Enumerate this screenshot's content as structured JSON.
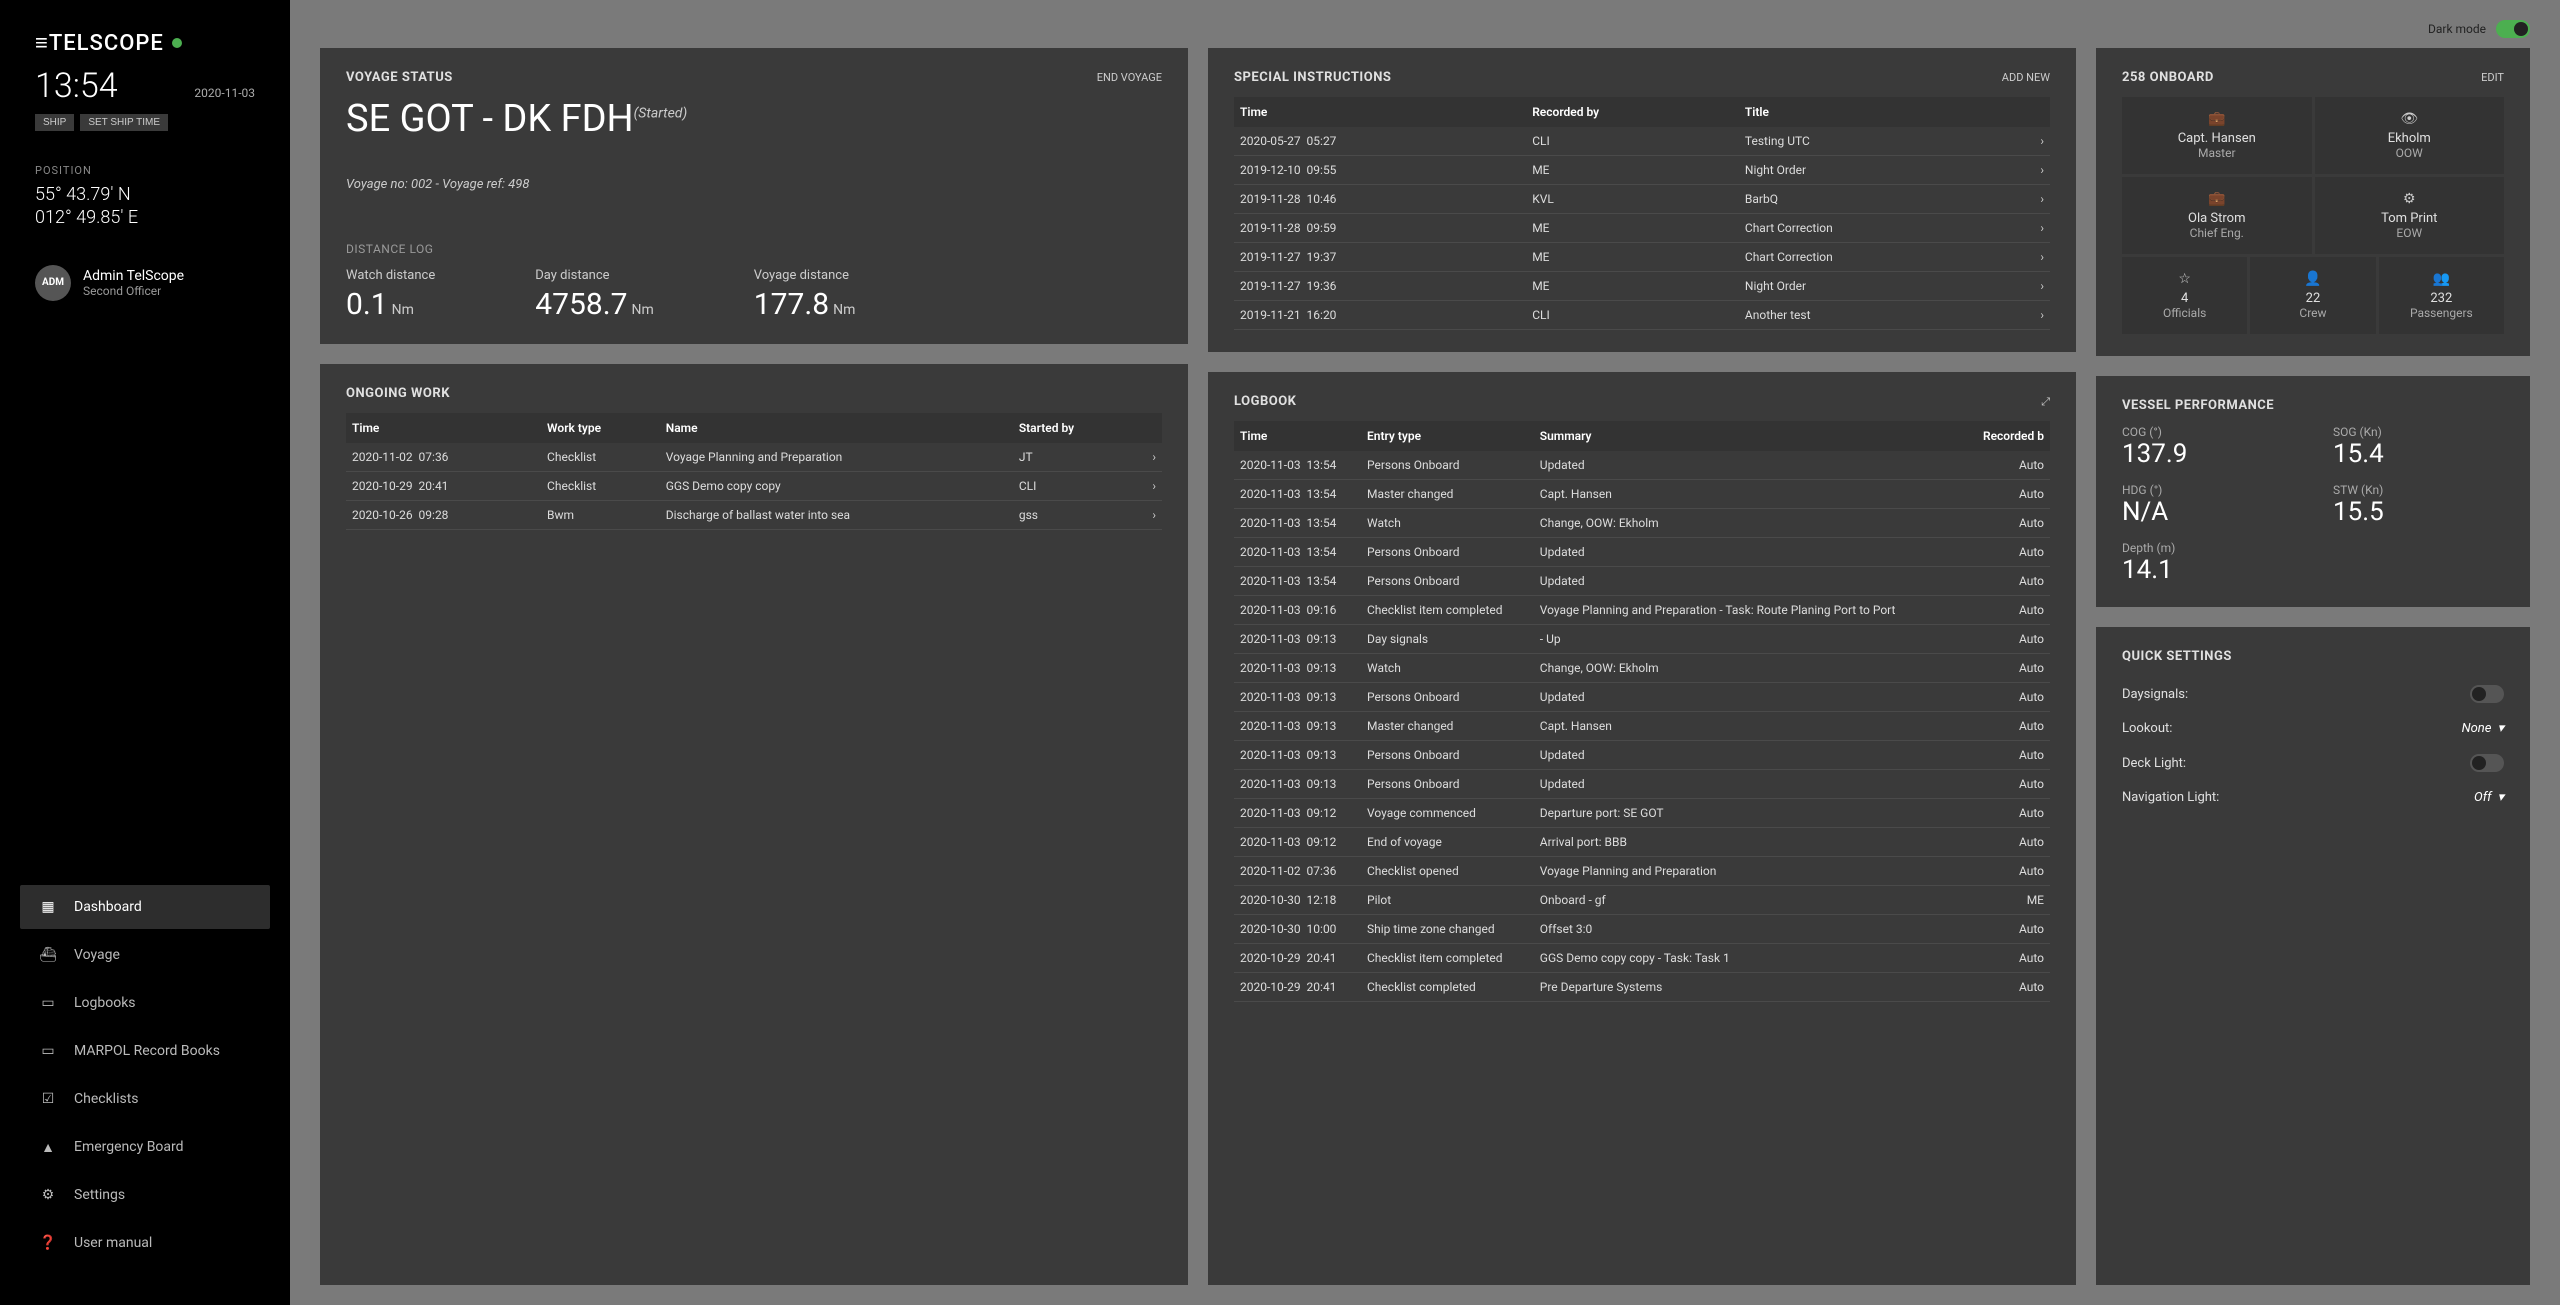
{
  "brand": "≡TELSCOPE",
  "clock": {
    "time": "13:54",
    "date": "2020-11-03"
  },
  "ship_buttons": {
    "ship": "SHIP",
    "set_time": "SET SHIP TIME"
  },
  "position": {
    "label": "POSITION",
    "lat": "55° 43.79' N",
    "lon": "012° 49.85' E"
  },
  "user": {
    "badge": "ADM",
    "name": "Admin TelScope",
    "role": "Second Officer"
  },
  "nav": {
    "dashboard": "Dashboard",
    "voyage": "Voyage",
    "logbooks": "Logbooks",
    "marpol": "MARPOL Record Books",
    "checklists": "Checklists",
    "emergency": "Emergency Board",
    "settings": "Settings",
    "manual": "User manual"
  },
  "topbar": {
    "dark_mode": "Dark mode"
  },
  "voyage_status": {
    "title": "VOYAGE STATUS",
    "action": "END VOYAGE",
    "route": "SE GOT - DK FDH",
    "status": "(Started)",
    "ref": "Voyage no: 002 - Voyage ref: 498",
    "distlog_label": "DISTANCE LOG",
    "watch": {
      "label": "Watch distance",
      "value": "0.1",
      "unit": "Nm"
    },
    "day": {
      "label": "Day distance",
      "value": "4758.7",
      "unit": "Nm"
    },
    "voyage": {
      "label": "Voyage distance",
      "value": "177.8",
      "unit": "Nm"
    }
  },
  "ongoing": {
    "title": "ONGOING WORK",
    "headers": {
      "time": "Time",
      "type": "Work type",
      "name": "Name",
      "by": "Started by"
    },
    "rows": [
      {
        "date": "2020-11-02",
        "time": "07:36",
        "type": "Checklist",
        "name": "Voyage Planning and Preparation",
        "by": "JT"
      },
      {
        "date": "2020-10-29",
        "time": "20:41",
        "type": "Checklist",
        "name": "GGS Demo copy copy",
        "by": "CLI"
      },
      {
        "date": "2020-10-26",
        "time": "09:28",
        "type": "Bwm",
        "name": "Discharge of ballast water into sea",
        "by": "gss"
      }
    ]
  },
  "instructions": {
    "title": "SPECIAL INSTRUCTIONS",
    "action": "ADD NEW",
    "headers": {
      "time": "Time",
      "by": "Recorded by",
      "title": "Title"
    },
    "rows": [
      {
        "date": "2020-05-27",
        "time": "05:27",
        "by": "CLI",
        "title": "Testing UTC"
      },
      {
        "date": "2019-12-10",
        "time": "09:55",
        "by": "ME",
        "title": "Night Order"
      },
      {
        "date": "2019-11-28",
        "time": "10:46",
        "by": "KVL",
        "title": "BarbQ"
      },
      {
        "date": "2019-11-28",
        "time": "09:59",
        "by": "ME",
        "title": "Chart Correction"
      },
      {
        "date": "2019-11-27",
        "time": "19:37",
        "by": "ME",
        "title": "Chart Correction"
      },
      {
        "date": "2019-11-27",
        "time": "19:36",
        "by": "ME",
        "title": "Night Order"
      },
      {
        "date": "2019-11-21",
        "time": "16:20",
        "by": "CLI",
        "title": "Another test"
      }
    ]
  },
  "logbook": {
    "title": "LOGBOOK",
    "headers": {
      "time": "Time",
      "type": "Entry type",
      "summary": "Summary",
      "by": "Recorded b"
    },
    "rows": [
      {
        "date": "2020-11-03",
        "time": "13:54",
        "type": "Persons Onboard",
        "summary": "Updated",
        "by": "Auto"
      },
      {
        "date": "2020-11-03",
        "time": "13:54",
        "type": "Master changed",
        "summary": "Capt. Hansen",
        "by": "Auto"
      },
      {
        "date": "2020-11-03",
        "time": "13:54",
        "type": "Watch",
        "summary": "Change, OOW: Ekholm",
        "by": "Auto"
      },
      {
        "date": "2020-11-03",
        "time": "13:54",
        "type": "Persons Onboard",
        "summary": "Updated",
        "by": "Auto"
      },
      {
        "date": "2020-11-03",
        "time": "13:54",
        "type": "Persons Onboard",
        "summary": "Updated",
        "by": "Auto"
      },
      {
        "date": "2020-11-03",
        "time": "09:16",
        "type": "Checklist item completed",
        "summary": "Voyage Planning and Preparation - Task: Route Planing Port to Port",
        "by": "Auto"
      },
      {
        "date": "2020-11-03",
        "time": "09:13",
        "type": "Day signals",
        "summary": "- Up",
        "by": "Auto"
      },
      {
        "date": "2020-11-03",
        "time": "09:13",
        "type": "Watch",
        "summary": "Change, OOW: Ekholm",
        "by": "Auto"
      },
      {
        "date": "2020-11-03",
        "time": "09:13",
        "type": "Persons Onboard",
        "summary": "Updated",
        "by": "Auto"
      },
      {
        "date": "2020-11-03",
        "time": "09:13",
        "type": "Master changed",
        "summary": "Capt. Hansen",
        "by": "Auto"
      },
      {
        "date": "2020-11-03",
        "time": "09:13",
        "type": "Persons Onboard",
        "summary": "Updated",
        "by": "Auto"
      },
      {
        "date": "2020-11-03",
        "time": "09:13",
        "type": "Persons Onboard",
        "summary": "Updated",
        "by": "Auto"
      },
      {
        "date": "2020-11-03",
        "time": "09:12",
        "type": "Voyage commenced",
        "summary": "Departure port: SE GOT",
        "by": "Auto"
      },
      {
        "date": "2020-11-03",
        "time": "09:12",
        "type": "End of voyage",
        "summary": "Arrival port: BBB",
        "by": "Auto"
      },
      {
        "date": "2020-11-02",
        "time": "07:36",
        "type": "Checklist opened",
        "summary": "Voyage Planning and Preparation",
        "by": "Auto"
      },
      {
        "date": "2020-10-30",
        "time": "12:18",
        "type": "Pilot",
        "summary": "Onboard - gf",
        "by": "ME"
      },
      {
        "date": "2020-10-30",
        "time": "10:00",
        "type": "Ship time zone changed",
        "summary": "Offset 3:0",
        "by": "Auto"
      },
      {
        "date": "2020-10-29",
        "time": "20:41",
        "type": "Checklist item completed",
        "summary": "GGS Demo copy copy - Task: Task 1",
        "by": "Auto"
      },
      {
        "date": "2020-10-29",
        "time": "20:41",
        "type": "Checklist completed",
        "summary": "Pre Departure Systems",
        "by": "Auto"
      }
    ]
  },
  "onboard": {
    "title": "258 ONBOARD",
    "action": "EDIT",
    "crew": [
      {
        "icon": "briefcase",
        "name": "Capt. Hansen",
        "role": "Master"
      },
      {
        "icon": "eye",
        "name": "Ekholm",
        "role": "OOW"
      },
      {
        "icon": "briefcase",
        "name": "Ola Strom",
        "role": "Chief Eng."
      },
      {
        "icon": "gear",
        "name": "Tom Print",
        "role": "EOW"
      }
    ],
    "counts": [
      {
        "icon": "star",
        "value": "4",
        "label": "Officials"
      },
      {
        "icon": "person",
        "value": "22",
        "label": "Crew"
      },
      {
        "icon": "people",
        "value": "232",
        "label": "Passengers"
      }
    ]
  },
  "performance": {
    "title": "VESSEL PERFORMANCE",
    "items": [
      {
        "label": "COG (°)",
        "value": "137.9"
      },
      {
        "label": "SOG (Kn)",
        "value": "15.4"
      },
      {
        "label": "HDG (°)",
        "value": "N/A"
      },
      {
        "label": "STW (Kn)",
        "value": "15.5"
      },
      {
        "label": "Depth (m)",
        "value": "14.1"
      }
    ]
  },
  "quick": {
    "title": "QUICK SETTINGS",
    "daysignals": "Daysignals:",
    "lookout": "Lookout:",
    "lookout_val": "None",
    "deck": "Deck Light:",
    "navlight": "Navigation Light:",
    "navlight_val": "Off"
  }
}
